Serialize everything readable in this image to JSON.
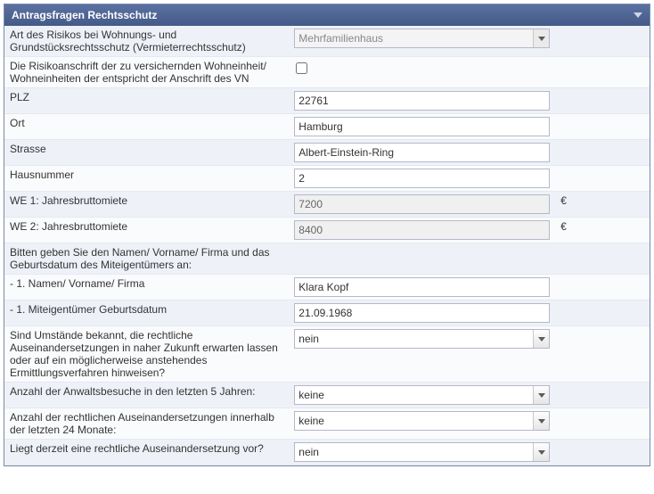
{
  "panel": {
    "title": "Antragsfragen Rechtsschutz"
  },
  "fields": {
    "risk_type": {
      "label": "Art des Risikos bei Wohnungs- und Grundstücksrechtsschutz (Vermieterrechtsschutz)",
      "value": "Mehrfamilienhaus"
    },
    "risk_address_matches": {
      "label": "Die Risikoanschrift der zu versichernden Wohneinheit/ Wohneinheiten der entspricht der Anschrift des VN"
    },
    "plz": {
      "label": "PLZ",
      "value": "22761"
    },
    "ort": {
      "label": "Ort",
      "value": "Hamburg"
    },
    "strasse": {
      "label": "Strasse",
      "value": "Albert-Einstein-Ring"
    },
    "hausnummer": {
      "label": "Hausnummer",
      "value": "2"
    },
    "we1_rent": {
      "label": "WE 1: Jahresbruttomiete",
      "value": "7200",
      "suffix": "€"
    },
    "we2_rent": {
      "label": "WE 2: Jahresbruttomiete",
      "value": "8400",
      "suffix": "€"
    },
    "coowner_intro": {
      "label": "Bitten geben Sie den Namen/ Vorname/ Firma und das Geburtsdatum des Miteigentümers an:"
    },
    "coowner_name": {
      "label": "- 1. Namen/ Vorname/ Firma",
      "value": "Klara Kopf"
    },
    "coowner_dob": {
      "label": "- 1. Miteigentümer Geburtsdatum",
      "value": "21.09.1968"
    },
    "circumstances": {
      "label": "Sind Umstände bekannt, die rechtliche Auseinandersetzungen in naher Zukunft erwarten lassen oder auf ein möglicherweise anstehendes Ermittlungsverfahren hinweisen?",
      "value": "nein"
    },
    "lawyer_visits": {
      "label": "Anzahl der Anwaltsbesuche in den letzten 5 Jahren:",
      "value": "keine"
    },
    "disputes_24m": {
      "label": "Anzahl der rechtlichen Auseinandersetzungen innerhalb der letzten 24 Monate:",
      "value": "keine"
    },
    "current_dispute": {
      "label": "Liegt derzeit eine rechtliche Auseinandersetzung vor?",
      "value": "nein"
    }
  }
}
